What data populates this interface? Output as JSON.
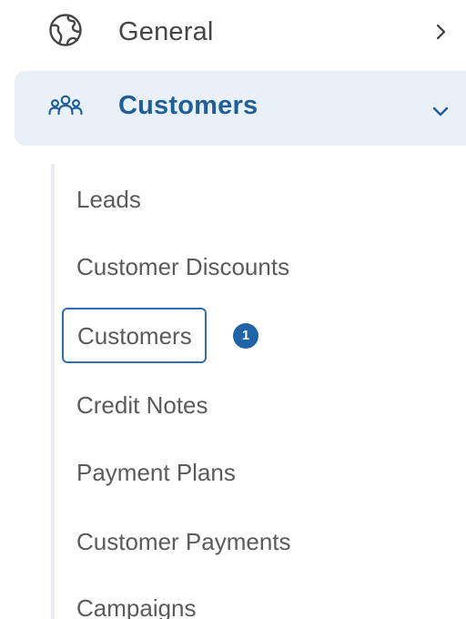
{
  "nav": {
    "general": {
      "label": "General",
      "icon": "globe-icon",
      "chevron": "chevron-right-icon"
    },
    "customers": {
      "label": "Customers",
      "icon": "users-icon",
      "chevron": "chevron-down-icon",
      "expanded": true
    },
    "sub_items": [
      {
        "label": "Leads"
      },
      {
        "label": "Customer Discounts"
      },
      {
        "label": "Customers",
        "active": true,
        "badge": "1"
      },
      {
        "label": "Credit Notes"
      },
      {
        "label": "Payment Plans"
      },
      {
        "label": "Customer Payments"
      },
      {
        "label": "Campaigns"
      }
    ]
  },
  "colors": {
    "accent": "#1f5f99",
    "active_bg": "#e9f0f8",
    "badge_bg": "#1f63a8",
    "text": "#454545"
  }
}
